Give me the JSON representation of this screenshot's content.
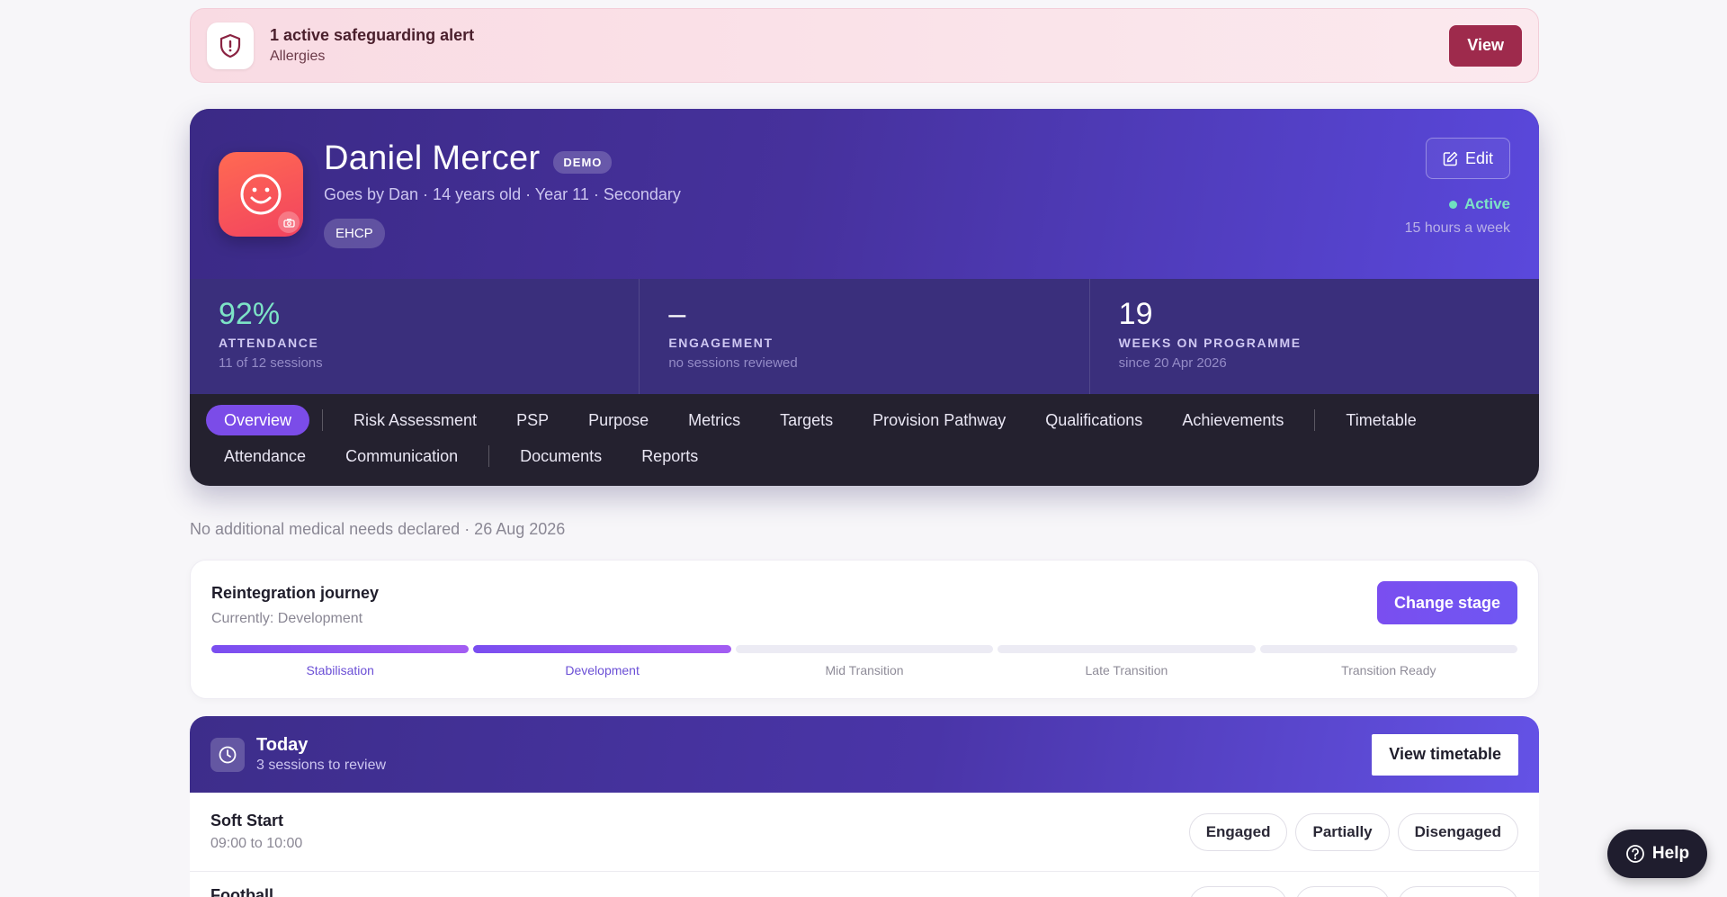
{
  "alert": {
    "title": "1 active safeguarding alert",
    "subtitle": "Allergies",
    "button": "View"
  },
  "profile": {
    "name": "Daniel Mercer",
    "demo_badge": "DEMO",
    "subline": "Goes by Dan · 14 years old · Year 11 · Secondary",
    "tag": "EHCP",
    "edit_label": "Edit",
    "status": "Active",
    "hours": "15 hours a week"
  },
  "stats": [
    {
      "value": "92%",
      "label": "ATTENDANCE",
      "sub": "11 of 12 sessions"
    },
    {
      "value": "–",
      "label": "ENGAGEMENT",
      "sub": "no sessions reviewed"
    },
    {
      "value": "19",
      "label": "WEEKS ON PROGRAMME",
      "sub": "since 20 Apr 2026"
    }
  ],
  "tabs": {
    "overview": "Overview",
    "risk": "Risk Assessment",
    "psp": "PSP",
    "purpose": "Purpose",
    "metrics": "Metrics",
    "targets": "Targets",
    "provision": "Provision Pathway",
    "qualifications": "Qualifications",
    "achievements": "Achievements",
    "timetable": "Timetable",
    "attendance": "Attendance",
    "communication": "Communication",
    "documents": "Documents",
    "reports": "Reports"
  },
  "medical_note": "No additional medical needs declared · 26 Aug 2026",
  "journey": {
    "title": "Reintegration journey",
    "current": "Currently: Development",
    "button": "Change stage",
    "stages": [
      "Stabilisation",
      "Development",
      "Mid Transition",
      "Late Transition",
      "Transition Ready"
    ],
    "completed_count": 2
  },
  "today": {
    "title": "Today",
    "subtitle": "3 sessions to review",
    "button": "View timetable",
    "sessions": [
      {
        "name": "Soft Start",
        "time": "09:00 to 10:00"
      },
      {
        "name": "Football",
        "time": ""
      }
    ],
    "options": [
      "Engaged",
      "Partially",
      "Disengaged"
    ]
  },
  "help": {
    "label": "Help"
  },
  "colors": {
    "accent": "#7b4ce8",
    "alert": "#9e2a4c",
    "active": "#7de3c6"
  }
}
